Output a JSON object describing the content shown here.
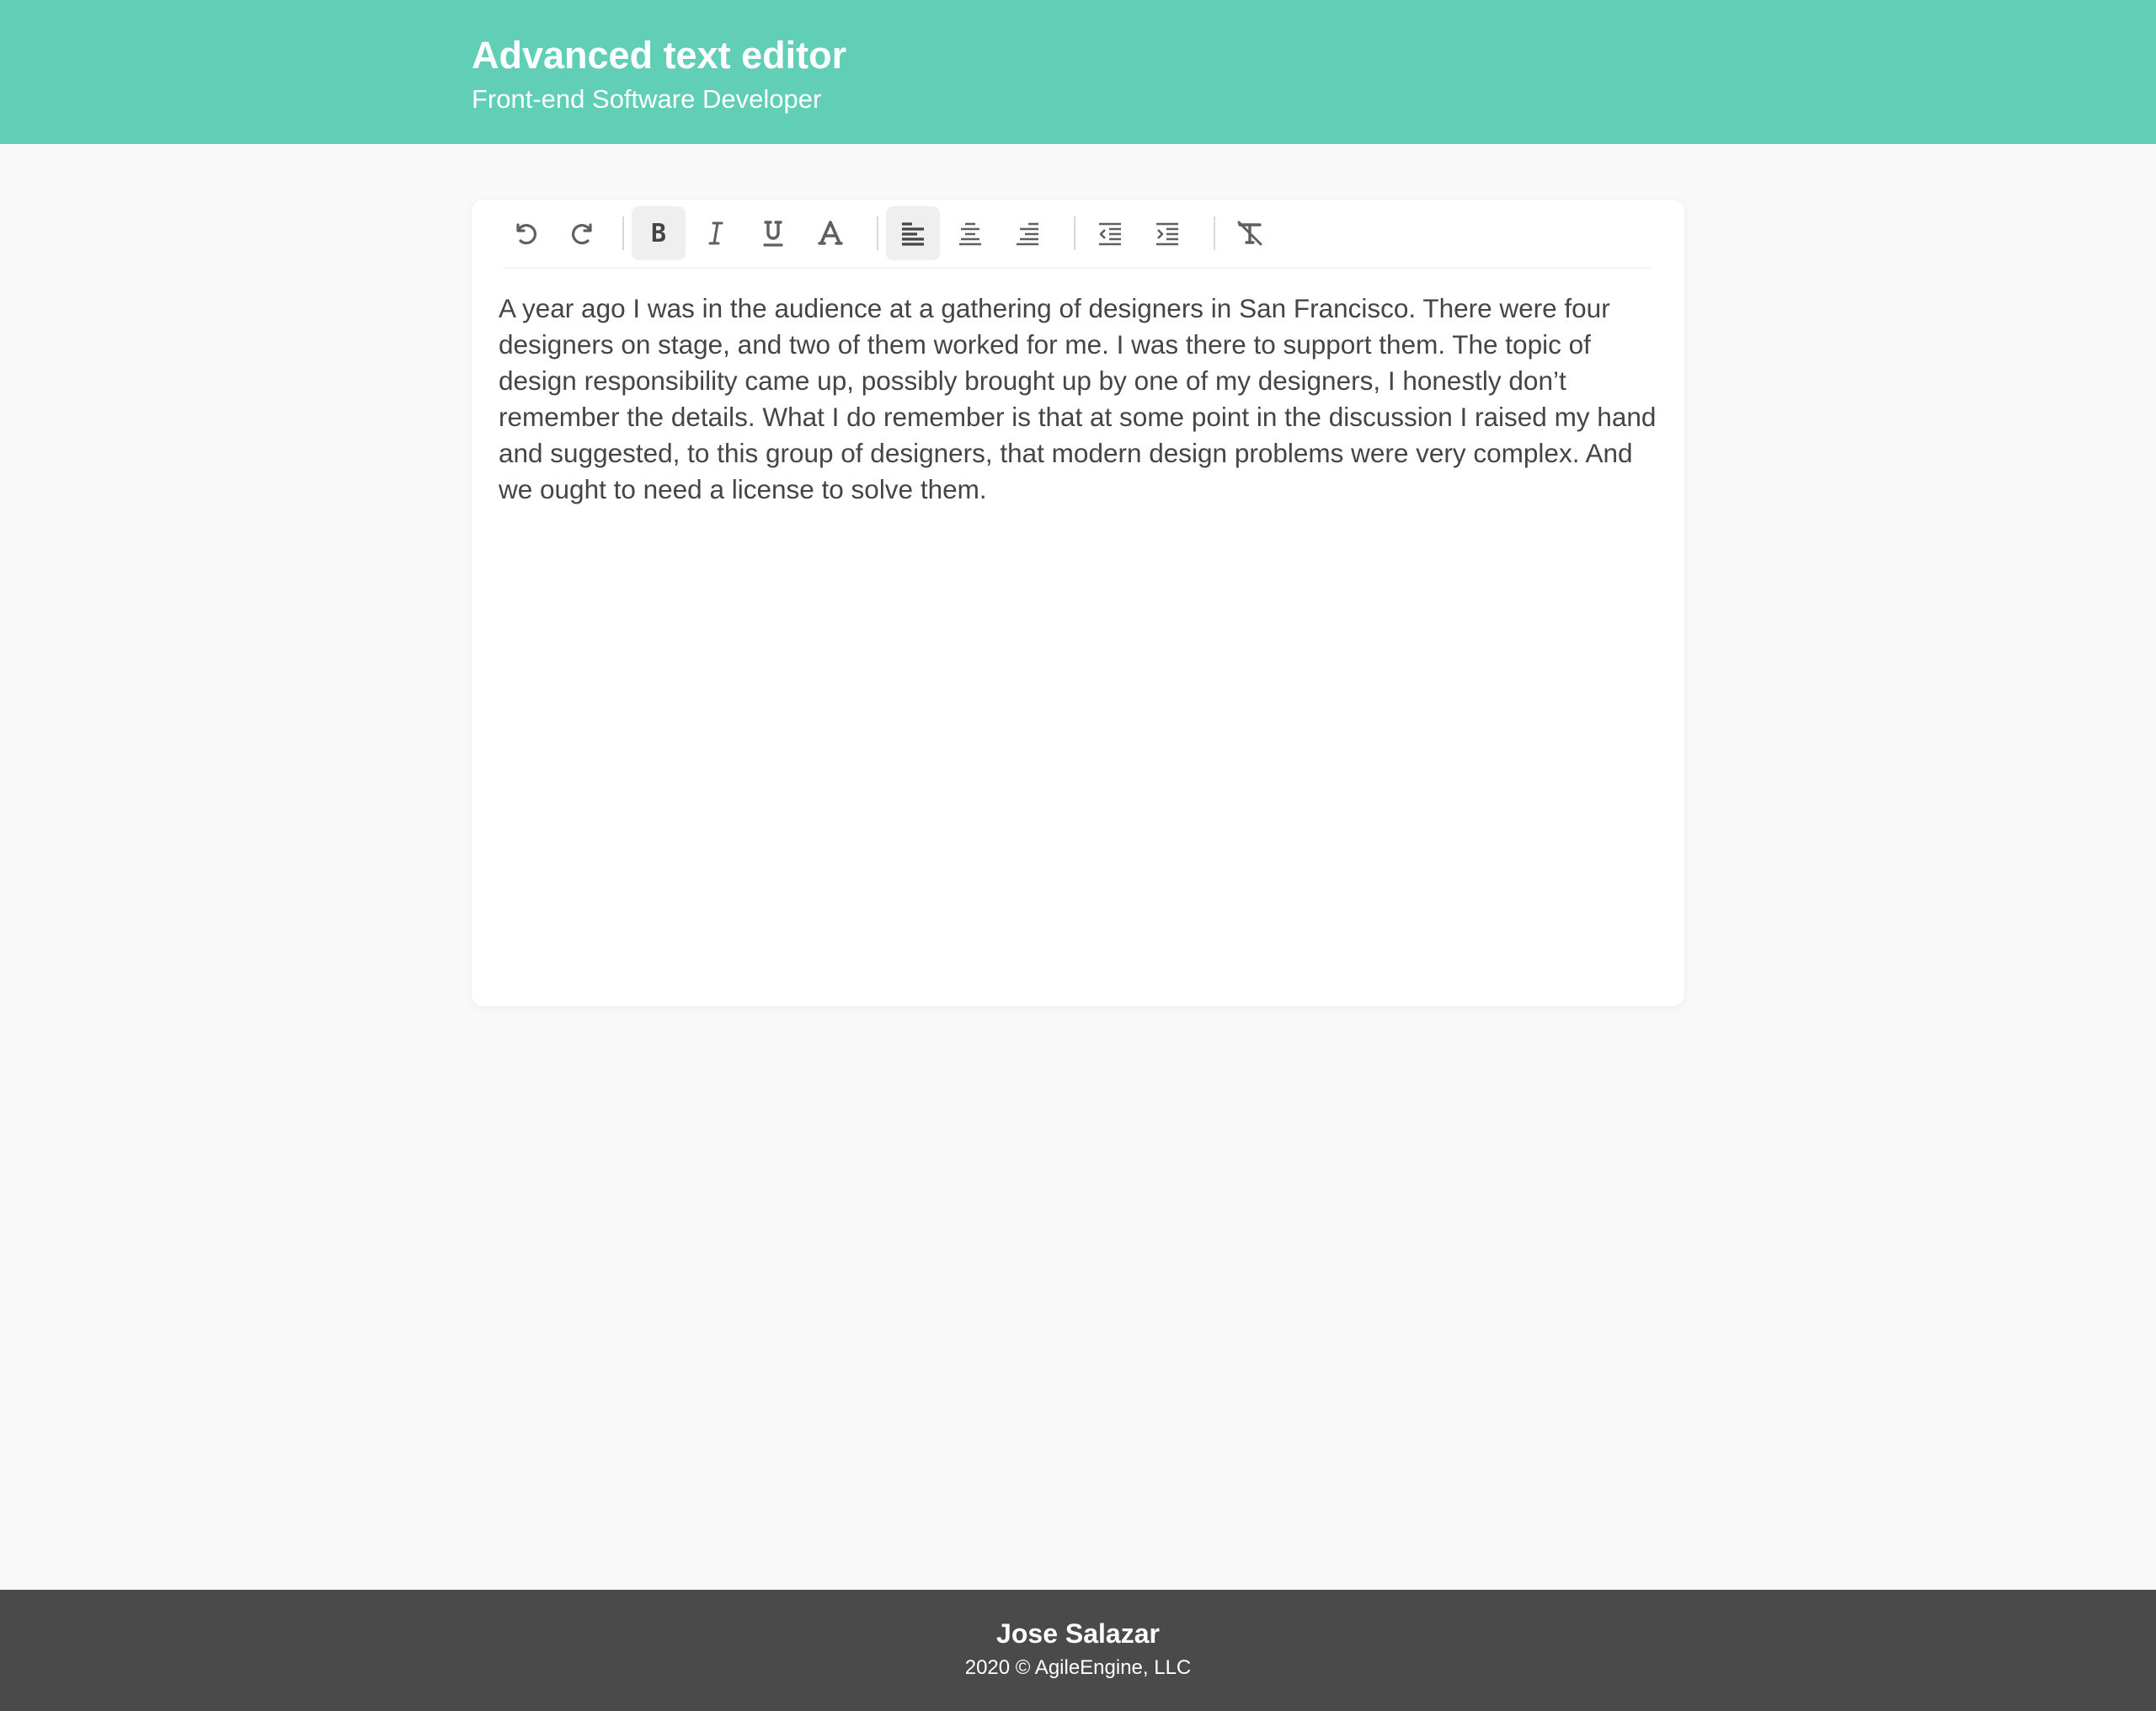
{
  "header": {
    "title": "Advanced text editor",
    "subtitle": "Front-end Software Developer"
  },
  "toolbar": {
    "buttons": [
      {
        "name": "undo",
        "icon": "undo-icon"
      },
      {
        "name": "redo",
        "icon": "redo-icon"
      },
      {
        "name": "bold",
        "icon": "bold-icon",
        "active": true
      },
      {
        "name": "italic",
        "icon": "italic-icon"
      },
      {
        "name": "underline",
        "icon": "underline-icon"
      },
      {
        "name": "font-color",
        "icon": "font-color-icon"
      },
      {
        "name": "align-left",
        "icon": "align-left-icon",
        "active": true
      },
      {
        "name": "align-center",
        "icon": "align-center-icon"
      },
      {
        "name": "align-right",
        "icon": "align-right-icon"
      },
      {
        "name": "outdent",
        "icon": "outdent-icon"
      },
      {
        "name": "indent",
        "icon": "indent-icon"
      },
      {
        "name": "clear-formatting",
        "icon": "clear-formatting-icon"
      }
    ]
  },
  "editor": {
    "content": "A year ago I was in the audience at a gathering of designers in San Francisco. There were four designers on stage, and two of them worked for me. I was there to support them. The topic of design responsibility came up, possibly brought up by one of my designers, I honestly don’t remember the details. What I do remember is that at some point in the discussion I raised my hand and suggested, to this group of designers, that modern design problems were very complex. And we ought to need a license to solve them."
  },
  "footer": {
    "name": "Jose Salazar",
    "copyright": "2020 © AgileEngine, LLC"
  },
  "colors": {
    "header_bg": "#61cfb5",
    "page_bg": "#f9f9f9",
    "footer_bg": "#4a4a4a",
    "icon": "#5f5f5f",
    "text": "#454545"
  }
}
